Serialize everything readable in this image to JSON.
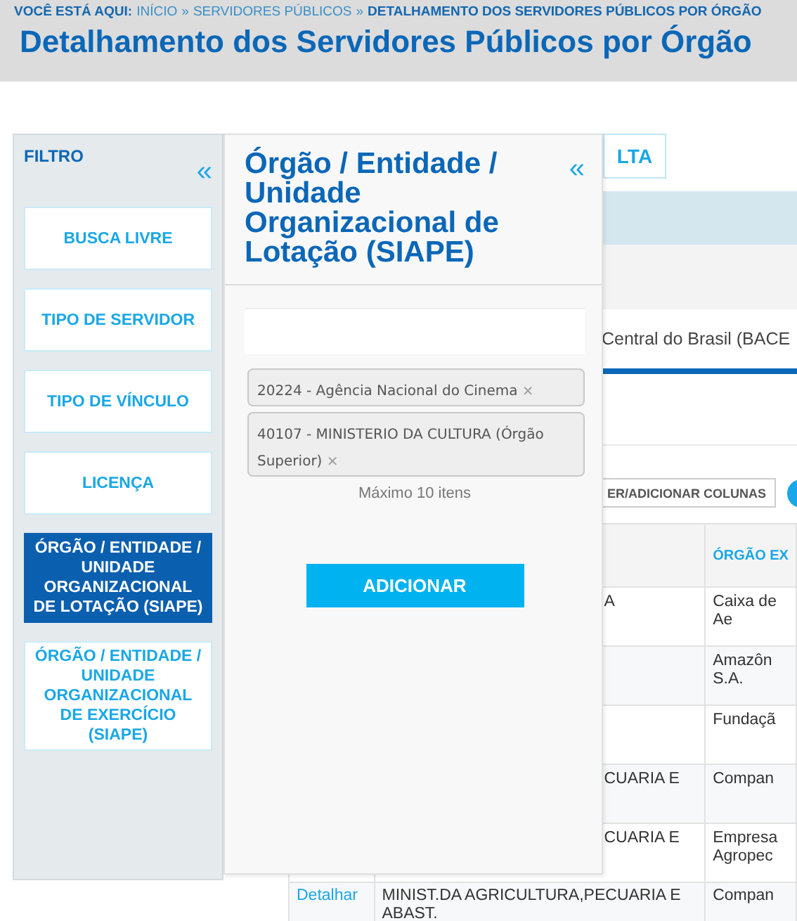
{
  "breadcrumb": {
    "label": "VOCÊ ESTÁ AQUI:",
    "separator": "»",
    "items": [
      {
        "label": "INÍCIO",
        "current": false
      },
      {
        "label": "SERVIDORES PÚBLICOS",
        "current": false
      },
      {
        "label": "DETALHAMENTO DOS SERVIDORES PÚBLICOS POR ÓRGÃO",
        "current": true
      }
    ]
  },
  "page_title": "Detalhamento dos Servidores Públicos por Órgão",
  "background": {
    "consult_button": "LTA",
    "selected_org": "Central do Brasil (BACE",
    "columns_button": "ER/ADICIONAR COLUNAS",
    "table": {
      "column_3_header": "ÓRGÃO EX",
      "rows": [
        {
          "column_2": "A",
          "column_3": "Caixa de Ae"
        },
        {
          "column_3": "Amazôn S.A."
        },
        {
          "column_3": "Fundaçã"
        },
        {
          "column_2": "CUARIA E",
          "column_3": "Compan"
        },
        {
          "column_2": "CUARIA E",
          "column_3": "Empresa Agropec"
        },
        {
          "action": "Detalhar",
          "column_2": "MINIST.DA AGRICULTURA,PECUARIA E ABAST.",
          "column_3": "Compan"
        }
      ]
    }
  },
  "filter": {
    "title": "FILTRO",
    "collapse": "«",
    "items": [
      {
        "label": "BUSCA LIVRE",
        "selected": false
      },
      {
        "label": "TIPO DE SERVIDOR",
        "selected": false
      },
      {
        "label": "TIPO DE VÍNCULO",
        "selected": false
      },
      {
        "label": "LICENÇA",
        "selected": false
      },
      {
        "label": "ÓRGÃO / ENTIDADE / UNIDADE ORGANIZACIONAL DE LOTAÇÃO (SIAPE)",
        "selected": true
      },
      {
        "label": "ÓRGÃO / ENTIDADE / UNIDADE ORGANIZACIONAL DE EXERCÍCIO (SIAPE)",
        "selected": false
      }
    ]
  },
  "panel": {
    "title": "Órgão / Entidade / Unidade Organizacional de Lotação (SIAPE)",
    "collapse": "«",
    "tags": [
      {
        "label": "20224 - Agência Nacional do Cinema",
        "remove": "×"
      },
      {
        "label": "40107 - MINISTERIO DA CULTURA (Órgão Superior)",
        "remove": "×"
      }
    ],
    "hint": "Máximo 10 itens",
    "button": "ADICIONAR"
  }
}
